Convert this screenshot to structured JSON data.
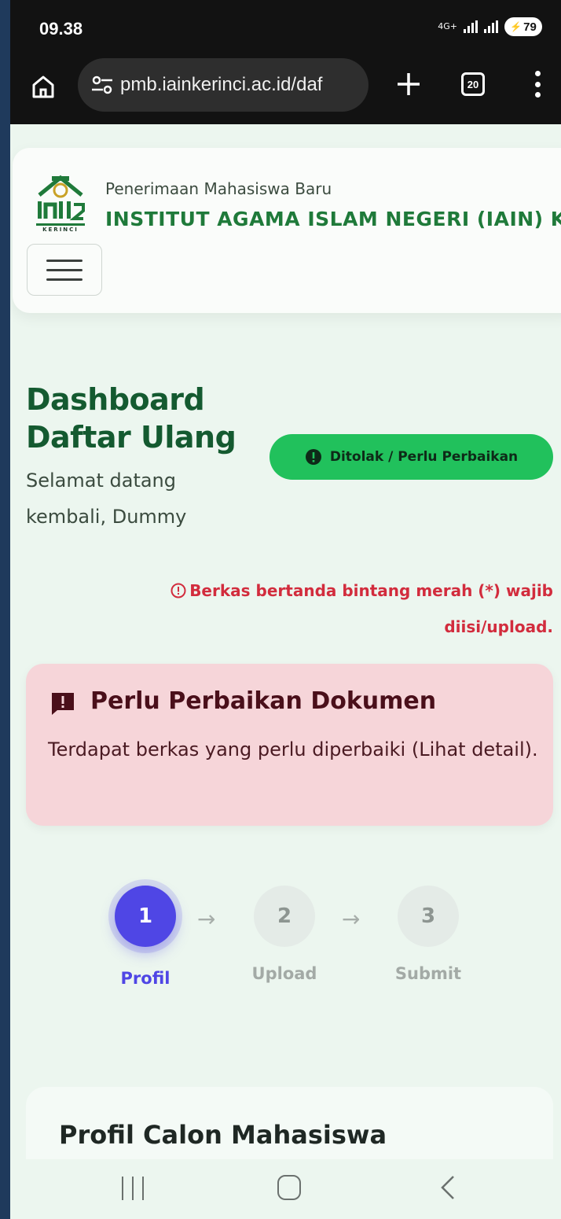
{
  "status_bar": {
    "time": "09.38",
    "network_label": "4G+",
    "battery": "79"
  },
  "browser": {
    "url": "pmb.iainkerinci.ac.id/daf",
    "tab_count": "20"
  },
  "header": {
    "subtitle": "Penerimaan Mahasiswa Baru",
    "title": "INSTITUT AGAMA ISLAM NEGERI (IAIN) KERINCI",
    "logo_text": "IAIN KERINCI"
  },
  "dashboard": {
    "title": "Dashboard Daftar Ulang",
    "welcome": "Selamat datang kembali, Dummy",
    "status_badge": "Ditolak / Perlu Perbaikan"
  },
  "note": {
    "text": "Berkas bertanda bintang merah (*) wajib diisi/upload."
  },
  "alert": {
    "title": "Perlu Perbaikan Dokumen",
    "text": "Terdapat berkas yang perlu diperbaiki (Lihat detail)."
  },
  "steps": [
    {
      "number": "1",
      "label": "Profil"
    },
    {
      "number": "2",
      "label": "Upload"
    },
    {
      "number": "3",
      "label": "Submit"
    }
  ],
  "steps_arrow": "→",
  "profile": {
    "title": "Profil Calon Mahasiswa"
  },
  "colors": {
    "brand_green": "#1f7a3a",
    "badge_green": "#21c15c",
    "step_active": "#4f46e5",
    "warning_red": "#d22c3d",
    "alert_bg": "#f6d5d9"
  }
}
